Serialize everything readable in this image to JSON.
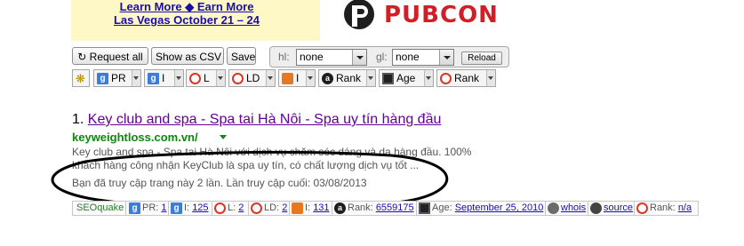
{
  "banner": {
    "line1": "Learn More ◆ Earn More",
    "line2": "Las Vegas October 21 – 24",
    "brand": "PUBCON"
  },
  "toolbar_buttons": {
    "request_all": "Request all",
    "show_csv": "Show as CSV",
    "save": "Save"
  },
  "hl": {
    "label": "hl:",
    "value": "none"
  },
  "gl": {
    "label": "gl:",
    "value": "none"
  },
  "reload": "Reload",
  "seoquake_bar": {
    "items": [
      {
        "icon": "gear-icon",
        "label": ""
      },
      {
        "icon": "google-pr-icon",
        "label": "PR"
      },
      {
        "icon": "google-index-icon",
        "label": "I"
      },
      {
        "icon": "yahoo-links-icon",
        "label": "L"
      },
      {
        "icon": "link-domain-icon",
        "label": "LD"
      },
      {
        "icon": "bing-index-icon",
        "label": "I"
      },
      {
        "icon": "alexa-rank-icon",
        "label": "Rank"
      },
      {
        "icon": "age-calendar-icon",
        "label": "Age"
      },
      {
        "icon": "semrush-rank-icon",
        "label": "Rank"
      }
    ]
  },
  "result": {
    "number": "1.",
    "title": "Key club and spa - Spa tai Hà Nôi - Spa uy tín hàng đầu",
    "url": "keyweightloss.com.vn/",
    "snippet_line1": "Key club and spa - Spa tai Hà Nôi với dịch vụ chăm sóc dáng và da hàng đầu. 100%",
    "snippet_line2": "khách hàng công nhận KeyClub là spa uy tín, có chất lượng dịch vụ tốt ...",
    "visit_note": "Bạn đã truy cập trang này 2 lần. Lần truy cập cuối: 03/08/2013"
  },
  "result_bar": {
    "brand": "SEOquake",
    "pr_label": "PR:",
    "pr_value": "1",
    "index_label": "I:",
    "index_value": "125",
    "links_label": "L:",
    "links_value": "2",
    "ld_label": "LD:",
    "ld_value": "2",
    "bing_label": "I:",
    "bing_value": "131",
    "rank_label": "Rank:",
    "rank_value": "6559175",
    "age_label": "Age:",
    "age_value": "September 25, 2010",
    "whois": "whois",
    "source": "source",
    "rank2_label": "Rank:",
    "rank2_value": "n/a"
  },
  "colors": {
    "visited_link": "#660099",
    "url_green": "#0a8a0a",
    "banner_bg": "#fdf8c6",
    "brand_red": "#d21f26",
    "annotation_ellipse": "#000000"
  }
}
